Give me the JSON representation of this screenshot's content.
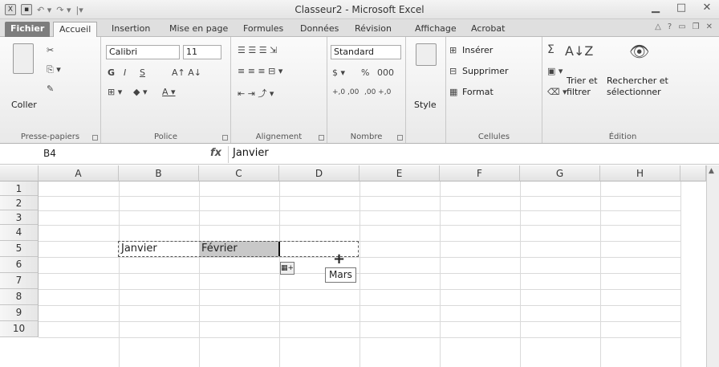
{
  "window": {
    "title": "Classeur2 - Microsoft Excel"
  },
  "tabs": [
    "Fichier",
    "Accueil",
    "Insertion",
    "Mise en page",
    "Formules",
    "Données",
    "Révision",
    "Affichage",
    "Acrobat"
  ],
  "ribbon": {
    "clipboard": {
      "paste": "Coller",
      "label": "Presse-papiers"
    },
    "font": {
      "name": "Calibri",
      "size": "11",
      "bold": "G",
      "italic": "I",
      "underline": "S",
      "label": "Police"
    },
    "alignment": {
      "label": "Alignement"
    },
    "number": {
      "format": "Standard",
      "percent": "%",
      "thousands": "000",
      "dec_inc": "+,0 ,00",
      "dec_dec": ",00 +,0",
      "label": "Nombre"
    },
    "styles": {
      "style": "Style"
    },
    "cells": {
      "insert": "Insérer",
      "delete": "Supprimer",
      "format": "Format",
      "label": "Cellules"
    },
    "editing": {
      "sum": "Σ",
      "sort": "Trier et",
      "sort2": "filtrer",
      "find": "Rechercher et",
      "find2": "sélectionner",
      "label": "Édition"
    }
  },
  "formula_bar": {
    "name_box": "B4",
    "fx": "fx",
    "value": "Janvier"
  },
  "grid": {
    "columns": [
      "A",
      "B",
      "C",
      "D",
      "E",
      "F",
      "G",
      "H"
    ],
    "rows": [
      "1",
      "2",
      "3",
      "4",
      "5",
      "6",
      "7",
      "8",
      "9",
      "10"
    ],
    "cells": {
      "B4": "Janvier",
      "C4": "Février"
    },
    "fill_tooltip": "Mars"
  }
}
